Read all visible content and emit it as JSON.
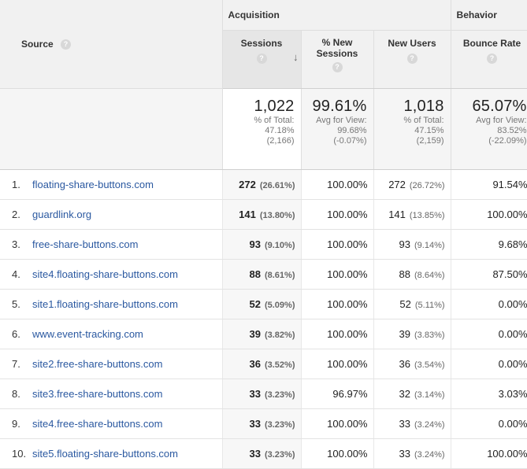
{
  "header": {
    "source_label": "Source",
    "groups": {
      "acquisition": "Acquisition",
      "behavior": "Behavior"
    },
    "help_glyph": "?",
    "columns": {
      "sessions": "Sessions",
      "pct_new_sessions_line1": "% New",
      "pct_new_sessions_line2": "Sessions",
      "new_users": "New Users",
      "bounce_rate": "Bounce Rate"
    },
    "sort_indicator": "↓"
  },
  "summary": {
    "sessions": {
      "value": "1,022",
      "line1": "% of Total:",
      "line2": "47.18%",
      "line3": "(2,166)"
    },
    "pct_new_sessions": {
      "value": "99.61%",
      "line1": "Avg for View:",
      "line2": "99.68%",
      "line3": "(-0.07%)"
    },
    "new_users": {
      "value": "1,018",
      "line1": "% of Total:",
      "line2": "47.15%",
      "line3": "(2,159)"
    },
    "bounce_rate": {
      "value": "65.07%",
      "line1": "Avg for View:",
      "line2": "83.52%",
      "line3": "(-22.09%)"
    }
  },
  "rows": [
    {
      "index": "1.",
      "source": "floating-share-buttons.com",
      "sessions": "272",
      "sessions_pct": "(26.61%)",
      "pct_new": "100.00%",
      "new_users": "272",
      "new_users_pct": "(26.72%)",
      "bounce": "91.54%"
    },
    {
      "index": "2.",
      "source": "guardlink.org",
      "sessions": "141",
      "sessions_pct": "(13.80%)",
      "pct_new": "100.00%",
      "new_users": "141",
      "new_users_pct": "(13.85%)",
      "bounce": "100.00%"
    },
    {
      "index": "3.",
      "source": "free-share-buttons.com",
      "sessions": "93",
      "sessions_pct": "(9.10%)",
      "pct_new": "100.00%",
      "new_users": "93",
      "new_users_pct": "(9.14%)",
      "bounce": "9.68%"
    },
    {
      "index": "4.",
      "source": "site4.floating-share-buttons.com",
      "sessions": "88",
      "sessions_pct": "(8.61%)",
      "pct_new": "100.00%",
      "new_users": "88",
      "new_users_pct": "(8.64%)",
      "bounce": "87.50%"
    },
    {
      "index": "5.",
      "source": "site1.floating-share-buttons.com",
      "sessions": "52",
      "sessions_pct": "(5.09%)",
      "pct_new": "100.00%",
      "new_users": "52",
      "new_users_pct": "(5.11%)",
      "bounce": "0.00%"
    },
    {
      "index": "6.",
      "source": "www.event-tracking.com",
      "sessions": "39",
      "sessions_pct": "(3.82%)",
      "pct_new": "100.00%",
      "new_users": "39",
      "new_users_pct": "(3.83%)",
      "bounce": "0.00%"
    },
    {
      "index": "7.",
      "source": "site2.free-share-buttons.com",
      "sessions": "36",
      "sessions_pct": "(3.52%)",
      "pct_new": "100.00%",
      "new_users": "36",
      "new_users_pct": "(3.54%)",
      "bounce": "0.00%"
    },
    {
      "index": "8.",
      "source": "site3.free-share-buttons.com",
      "sessions": "33",
      "sessions_pct": "(3.23%)",
      "pct_new": "96.97%",
      "new_users": "32",
      "new_users_pct": "(3.14%)",
      "bounce": "3.03%"
    },
    {
      "index": "9.",
      "source": "site4.free-share-buttons.com",
      "sessions": "33",
      "sessions_pct": "(3.23%)",
      "pct_new": "100.00%",
      "new_users": "33",
      "new_users_pct": "(3.24%)",
      "bounce": "0.00%"
    },
    {
      "index": "10.",
      "source": "site5.floating-share-buttons.com",
      "sessions": "33",
      "sessions_pct": "(3.23%)",
      "pct_new": "100.00%",
      "new_users": "33",
      "new_users_pct": "(3.24%)",
      "bounce": "100.00%"
    }
  ]
}
